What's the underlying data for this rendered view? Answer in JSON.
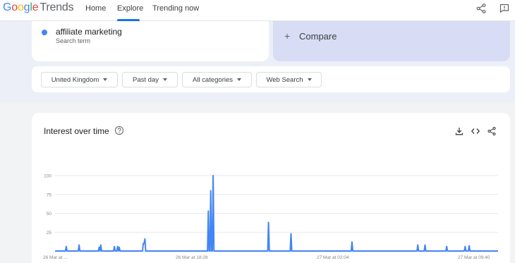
{
  "header": {
    "logo_google": "Google",
    "logo_trends": "Trends",
    "nav": [
      {
        "label": "Home"
      },
      {
        "label": "Explore"
      },
      {
        "label": "Trending now"
      }
    ]
  },
  "search": {
    "term": "affiliate marketing",
    "term_type": "Search term",
    "term_color": "#4285f4",
    "compare_label": "Compare"
  },
  "filters": [
    {
      "label": "United Kingdom"
    },
    {
      "label": "Past day"
    },
    {
      "label": "All categories"
    },
    {
      "label": "Web Search"
    }
  ],
  "chart_card": {
    "title": "Interest over time"
  },
  "chart_data": {
    "type": "line",
    "title": "Interest over time",
    "xlabel": "",
    "ylabel": "",
    "ylim": [
      0,
      100
    ],
    "yticks": [
      25,
      50,
      75,
      100
    ],
    "x_tick_labels": [
      "26 Mar at ...",
      "26 Mar at 18:28",
      "27 Mar at 02:04",
      "27 Mar at 09:40"
    ],
    "grid": true,
    "series": [
      {
        "color": "#4285f4",
        "values": [
          0,
          0,
          0,
          0,
          0,
          0,
          0,
          0,
          0,
          0,
          0,
          0,
          0,
          0,
          6,
          0,
          0,
          0,
          0,
          0,
          0,
          0,
          0,
          0,
          0,
          0,
          0,
          0,
          0,
          0,
          8,
          0,
          0,
          0,
          0,
          0,
          0,
          0,
          0,
          0,
          0,
          0,
          0,
          0,
          0,
          0,
          0,
          0,
          0,
          0,
          0,
          0,
          0,
          0,
          0,
          5,
          0,
          8,
          0,
          0,
          0,
          0,
          0,
          0,
          0,
          0,
          0,
          0,
          0,
          0,
          0,
          0,
          0,
          0,
          6,
          0,
          0,
          0,
          6,
          0,
          5,
          0,
          0,
          0,
          0,
          0,
          0,
          0,
          0,
          0,
          0,
          0,
          0,
          0,
          0,
          0,
          0,
          0,
          0,
          0,
          0,
          0,
          0,
          0,
          0,
          0,
          0,
          0,
          0,
          0,
          10,
          10,
          16,
          0,
          0,
          0,
          0,
          0,
          0,
          0,
          0,
          0,
          0,
          0,
          0,
          0,
          0,
          0,
          0,
          0,
          0,
          0,
          0,
          0,
          0,
          0,
          0,
          0,
          0,
          0,
          0,
          0,
          0,
          0,
          0,
          0,
          0,
          0,
          0,
          0,
          0,
          0,
          0,
          0,
          0,
          0,
          0,
          0,
          0,
          0,
          0,
          0,
          0,
          0,
          0,
          0,
          0,
          0,
          0,
          0,
          0,
          0,
          0,
          0,
          0,
          0,
          0,
          0,
          0,
          0,
          0,
          0,
          0,
          0,
          0,
          0,
          0,
          0,
          0,
          0,
          0,
          53,
          0,
          0,
          80,
          0,
          0,
          100,
          0,
          0,
          0,
          0,
          0,
          0,
          0,
          0,
          0,
          0,
          0,
          0,
          0,
          0,
          0,
          0,
          0,
          0,
          0,
          0,
          0,
          0,
          0,
          0,
          0,
          0,
          0,
          0,
          0,
          0,
          0,
          0,
          0,
          0,
          0,
          0,
          0,
          0,
          0,
          0,
          0,
          0,
          0,
          0,
          0,
          0,
          0,
          0,
          0,
          0,
          0,
          0,
          0,
          0,
          0,
          0,
          0,
          0,
          0,
          0,
          0,
          0,
          0,
          0,
          0,
          0,
          0,
          0,
          38,
          0,
          0,
          0,
          0,
          0,
          0,
          0,
          0,
          0,
          0,
          0,
          0,
          0,
          0,
          0,
          0,
          0,
          0,
          0,
          0,
          0,
          0,
          0,
          0,
          0,
          0,
          0,
          23,
          0,
          0,
          0,
          0,
          0,
          0,
          0,
          0,
          0,
          0,
          0,
          0,
          0,
          0,
          0,
          0,
          0,
          0,
          0,
          0,
          0,
          0,
          0,
          0,
          0,
          0,
          0,
          0,
          0,
          0,
          0,
          0,
          0,
          0,
          0,
          0,
          0,
          0,
          0,
          0,
          0,
          0,
          0,
          0,
          0,
          0,
          0,
          0,
          0,
          0,
          0,
          0,
          0,
          0,
          0,
          0,
          0,
          0,
          0,
          0,
          0,
          0,
          0,
          0,
          0,
          0,
          0,
          0,
          0,
          0,
          0,
          0,
          0,
          0,
          0,
          12,
          0,
          0,
          0,
          0,
          0,
          0,
          0,
          0,
          0,
          0,
          0,
          0,
          0,
          0,
          0,
          0,
          0,
          0,
          0,
          0,
          0,
          0,
          0,
          0,
          0,
          0,
          0,
          0,
          0,
          0,
          0,
          0,
          0,
          0,
          0,
          0,
          0,
          0,
          0,
          0,
          0,
          0,
          0,
          0,
          0,
          0,
          0,
          0,
          0,
          0,
          0,
          0,
          0,
          0,
          0,
          0,
          0,
          0,
          0,
          0,
          0,
          0,
          0,
          0,
          0,
          0,
          0,
          0,
          0,
          0,
          0,
          0,
          0,
          0,
          0,
          0,
          0,
          0,
          0,
          0,
          0,
          8,
          0,
          0,
          0,
          0,
          0,
          0,
          0,
          0,
          8,
          0,
          0,
          0,
          0,
          0,
          0,
          0,
          0,
          0,
          0,
          0,
          0,
          0,
          0,
          0,
          0,
          0,
          0,
          0,
          0,
          0,
          0,
          0,
          0,
          0,
          0,
          6,
          0,
          0,
          0,
          0,
          0,
          0,
          0,
          0,
          0,
          0,
          0,
          0,
          0,
          0,
          0,
          0,
          0,
          0,
          0,
          0,
          0,
          0,
          6,
          0,
          0,
          0,
          0,
          7,
          0,
          0,
          0,
          0,
          0,
          0,
          0,
          0,
          0,
          0,
          0,
          0,
          0,
          0,
          0,
          0,
          0,
          0,
          0,
          0,
          0,
          0,
          0,
          0,
          0,
          0,
          0,
          0,
          0,
          0,
          0,
          0,
          0,
          0,
          0,
          0
        ]
      }
    ]
  }
}
